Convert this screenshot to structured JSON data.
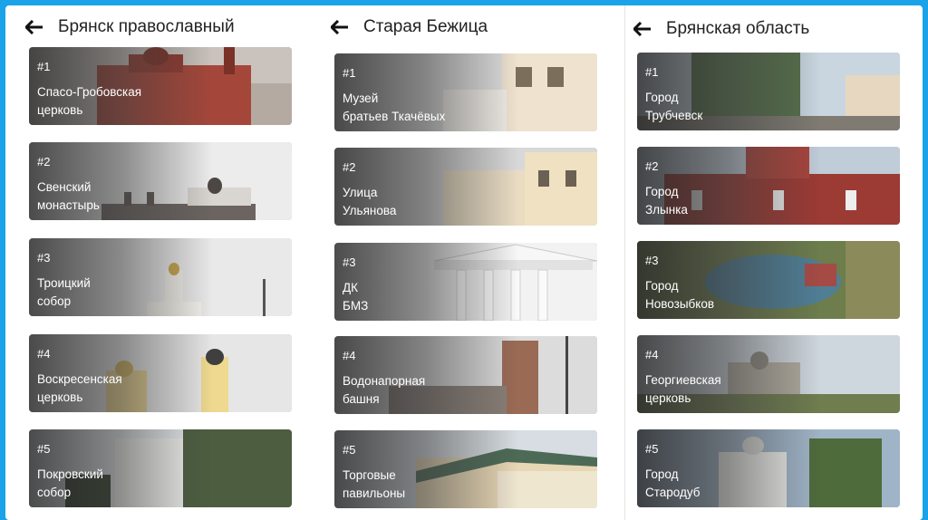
{
  "columns": [
    {
      "title": "Брянск православный",
      "cards": [
        {
          "num": "#1",
          "name": "Спасо-Гробовская\nцерковь"
        },
        {
          "num": "#2",
          "name": "Свенский\nмонастырь"
        },
        {
          "num": "#3",
          "name": "Троицкий\nсобор"
        },
        {
          "num": "#4",
          "name": "Воскресенская\nцерковь"
        },
        {
          "num": "#5",
          "name": "Покровский\nсобор"
        }
      ]
    },
    {
      "title": "Старая Бежица",
      "cards": [
        {
          "num": "#1",
          "name": "Музей\nбратьев Ткачёвых"
        },
        {
          "num": "#2",
          "name": "Улица\nУльянова"
        },
        {
          "num": "#3",
          "name": "ДК\nБМЗ"
        },
        {
          "num": "#4",
          "name": "Водонапорная\nбашня"
        },
        {
          "num": "#5",
          "name": "Торговые\nпавильоны"
        }
      ]
    },
    {
      "title": "Брянская область",
      "cards": [
        {
          "num": "#1",
          "name": "Город\nТрубчевск"
        },
        {
          "num": "#2",
          "name": "Город\nЗлынка"
        },
        {
          "num": "#3",
          "name": "Город\nНовозыбков"
        },
        {
          "num": "#4",
          "name": "Георгиевская\nцерковь"
        },
        {
          "num": "#5",
          "name": "Город\nСтародуб"
        }
      ]
    }
  ],
  "colors": {
    "frame_border": "#1aa3e8",
    "background": "#ffffff"
  },
  "icons": {
    "back": "arrow-left-icon"
  }
}
